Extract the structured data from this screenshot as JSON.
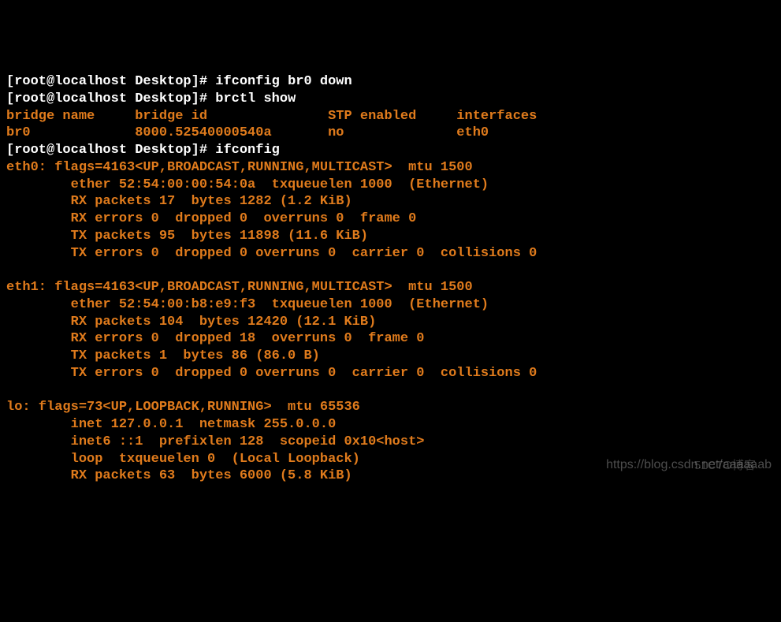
{
  "prompt1": "[root@localhost Desktop]# ",
  "cmd1": "ifconfig br0 down",
  "prompt2": "[root@localhost Desktop]# ",
  "cmd2": "brctl show",
  "brctl_header": "bridge name     bridge id               STP enabled     interfaces",
  "brctl_row": "br0             8000.52540000540a       no              eth0",
  "prompt3": "[root@localhost Desktop]# ",
  "cmd3": "ifconfig",
  "eth0": {
    "l1": "eth0: flags=4163<UP,BROADCAST,RUNNING,MULTICAST>  mtu 1500",
    "l2": "        ether 52:54:00:00:54:0a  txqueuelen 1000  (Ethernet)",
    "l3": "        RX packets 17  bytes 1282 (1.2 KiB)",
    "l4": "        RX errors 0  dropped 0  overruns 0  frame 0",
    "l5": "        TX packets 95  bytes 11898 (11.6 KiB)",
    "l6": "        TX errors 0  dropped 0 overruns 0  carrier 0  collisions 0"
  },
  "eth1": {
    "l1": "eth1: flags=4163<UP,BROADCAST,RUNNING,MULTICAST>  mtu 1500",
    "l2": "        ether 52:54:00:b8:e9:f3  txqueuelen 1000  (Ethernet)",
    "l3": "        RX packets 104  bytes 12420 (12.1 KiB)",
    "l4": "        RX errors 0  dropped 18  overruns 0  frame 0",
    "l5": "        TX packets 1  bytes 86 (86.0 B)",
    "l6": "        TX errors 0  dropped 0 overruns 0  carrier 0  collisions 0"
  },
  "lo": {
    "l1": "lo: flags=73<UP,LOOPBACK,RUNNING>  mtu 65536",
    "l2": "        inet 127.0.0.1  netmask 255.0.0.0",
    "l3": "        inet6 ::1  prefixlen 128  scopeid 0x10<host>",
    "l4": "        loop  txqueuelen 0  (Local Loopback)",
    "l5": "        RX packets 63  bytes 6000 (5.8 KiB)"
  },
  "watermark1": "https://blog.csdn.net/aaaaaab",
  "watermark2": "51CTO博客"
}
